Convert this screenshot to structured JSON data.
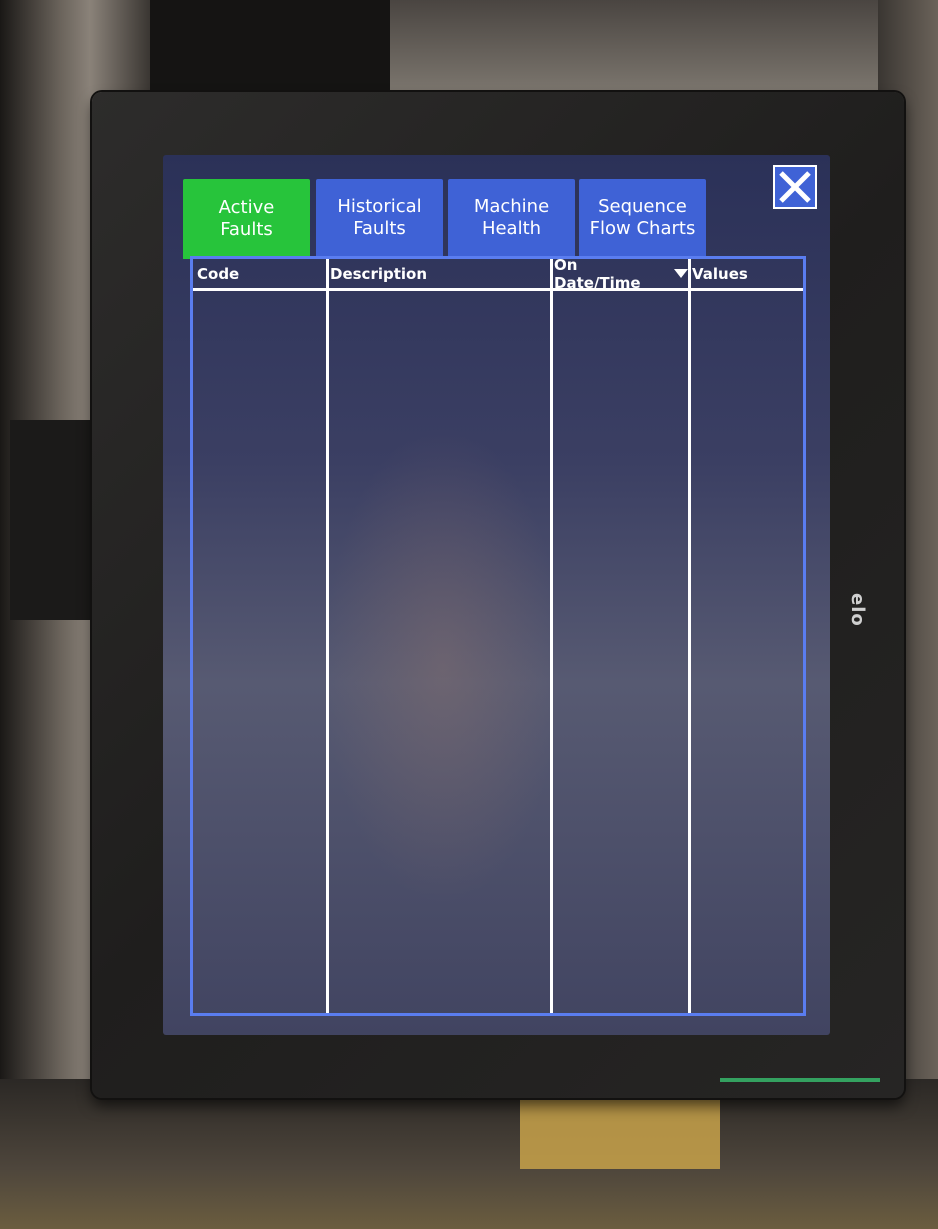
{
  "tabs": [
    {
      "label": "Active\nFaults",
      "active": true
    },
    {
      "label": "Historical\nFaults",
      "active": false
    },
    {
      "label": "Machine\nHealth",
      "active": false
    },
    {
      "label": "Sequence\nFlow Charts",
      "active": false
    }
  ],
  "table": {
    "columns": [
      "Code",
      "Description",
      "On Date/Time",
      "Values"
    ],
    "sorted_column": "On Date/Time",
    "rows": []
  },
  "monitor": {
    "brand": "elo"
  },
  "colors": {
    "active_tab": "#27c43b",
    "inactive_tab": "#3f62d6",
    "grid_border": "#5a7df0",
    "screen_background": "#2b3158"
  },
  "icons": {
    "close": "close-x-icon",
    "sort": "sort-desc-icon"
  }
}
